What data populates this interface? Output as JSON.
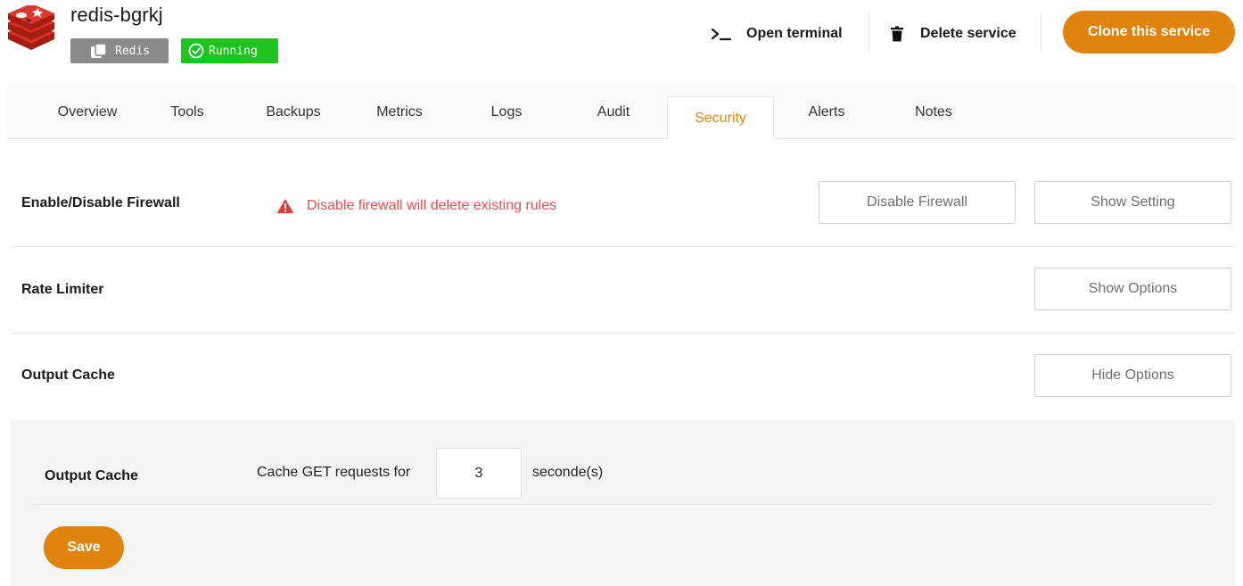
{
  "service": {
    "name": "redis-bgrkj",
    "logo_icon": "redis-logo-icon",
    "type_badge": "Redis",
    "status_badge": "Running",
    "colors": {
      "type_badge": "#8a8a8a",
      "status_badge": "#1fc31f"
    }
  },
  "header_actions": {
    "terminal_label": "Open terminal",
    "delete_label": "Delete service",
    "clone_label": "Clone this service"
  },
  "tabs": [
    {
      "label": "Overview"
    },
    {
      "label": "Tools"
    },
    {
      "label": "Backups"
    },
    {
      "label": "Metrics"
    },
    {
      "label": "Logs"
    },
    {
      "label": "Audit"
    },
    {
      "label": "Security",
      "active": true
    },
    {
      "label": "Alerts"
    },
    {
      "label": "Notes"
    }
  ],
  "security": {
    "firewall": {
      "label": "Enable/Disable Firewall",
      "warning": "Disable firewall will delete existing rules",
      "disable_button": "Disable Firewall",
      "settings_button": "Show Setting"
    },
    "rate_limiter": {
      "label": "Rate Limiter",
      "button": "Show Options"
    },
    "output_cache": {
      "label": "Output Cache",
      "button": "Hide Options",
      "panel": {
        "label": "Output Cache",
        "prefix": "Cache GET requests for",
        "seconds_value": "3",
        "suffix": "seconde(s)",
        "save_label": "Save"
      }
    }
  },
  "colors": {
    "accent": "#e0830f",
    "warning": "#ef4b4b"
  }
}
